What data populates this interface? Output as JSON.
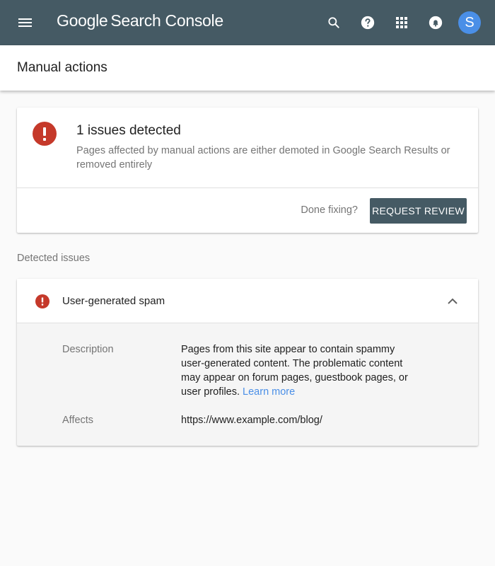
{
  "topbar": {
    "logo_google": "Google",
    "logo_product": "Search Console",
    "icons": [
      "menu-icon",
      "search-icon",
      "help-icon",
      "apps-icon",
      "notifications-icon"
    ],
    "avatar_letter": "S",
    "colors": {
      "bar": "#455a64",
      "avatar": "#4a8fe7"
    }
  },
  "page": {
    "title": "Manual actions"
  },
  "summary": {
    "title": "1 issues detected",
    "subtitle": "Pages affected by manual actions are either demoted in Google Search Results or removed entirely",
    "done_label": "Done fixing?",
    "request_review_label": "REQUEST REVIEW",
    "error_color": "#c5392a"
  },
  "detected": {
    "section_label": "Detected issues",
    "issues": [
      {
        "title": "User-generated spam",
        "expanded": true,
        "description_label": "Description",
        "description": "Pages from this site appear to contain spammy user-generated content. The problematic content may appear on forum pages, guestbook pages, or user profiles.",
        "learn_more": "Learn more",
        "affects_label": "Affects",
        "affects": "https://www.example.com/blog/"
      }
    ]
  }
}
